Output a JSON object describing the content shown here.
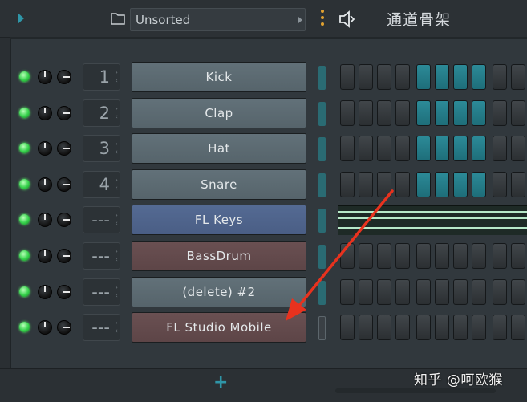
{
  "header": {
    "filter_value": "Unsorted",
    "rack_title": "通道骨架",
    "accent_color": "#2f96a8"
  },
  "channels": [
    {
      "route": "1",
      "name": "Kick",
      "color": "gray",
      "steps": [
        0,
        0,
        0,
        0,
        1,
        1,
        1,
        1,
        0,
        0
      ],
      "selected": true
    },
    {
      "route": "2",
      "name": "Clap",
      "color": "gray",
      "steps": [
        0,
        0,
        0,
        0,
        1,
        1,
        1,
        1,
        0,
        0
      ],
      "selected": true
    },
    {
      "route": "3",
      "name": "Hat",
      "color": "gray",
      "steps": [
        0,
        0,
        0,
        0,
        1,
        1,
        1,
        1,
        0,
        0
      ],
      "selected": true
    },
    {
      "route": "4",
      "name": "Snare",
      "color": "gray",
      "steps": [
        0,
        0,
        0,
        0,
        1,
        1,
        1,
        1,
        0,
        0
      ],
      "selected": true
    },
    {
      "route": "---",
      "name": "FL Keys",
      "color": "blue",
      "steps": null,
      "selected": true
    },
    {
      "route": "---",
      "name": "BassDrum",
      "color": "brown",
      "steps": [
        0,
        0,
        0,
        0,
        0,
        0,
        0,
        0,
        0,
        0
      ],
      "selected": true
    },
    {
      "route": "---",
      "name": "(delete) #2",
      "color": "gray",
      "steps": [
        0,
        0,
        0,
        0,
        0,
        0,
        0,
        0,
        0,
        0
      ],
      "selected": true
    },
    {
      "route": "---",
      "name": "FL Studio Mobile",
      "color": "brown",
      "steps": [
        0,
        0,
        0,
        0,
        0,
        0,
        0,
        0,
        0,
        0
      ],
      "selected": false
    }
  ],
  "footer": {
    "add_label": "+"
  },
  "watermark": "知乎 @呵欧猴",
  "icons": {
    "play": "play-arrow-icon",
    "folder": "folder-icon",
    "menu": "menu-dots-icon",
    "speaker": "speaker-icon"
  },
  "annotation_color": "#e8321e"
}
